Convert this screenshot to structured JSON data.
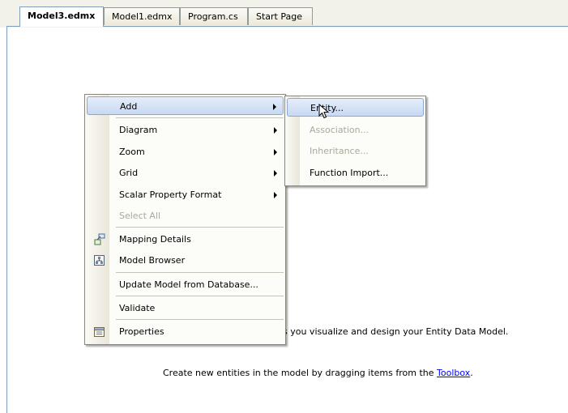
{
  "tabs": [
    {
      "label": "Model3.edmx",
      "active": true
    },
    {
      "label": "Model1.edmx",
      "active": false
    },
    {
      "label": "Program.cs",
      "active": false
    },
    {
      "label": "Start Page",
      "active": false
    }
  ],
  "designer": {
    "hint_line1_visible": "s you visualize and design your Entity Data Model.",
    "hint_line2_prefix": "Create new entities in the model by dragging items from the ",
    "hint_line2_link": "Toolbox",
    "hint_line2_suffix": "."
  },
  "context_menu": {
    "items": [
      {
        "label": "Add",
        "submenu": true,
        "highlighted": true
      },
      {
        "label": "Diagram",
        "submenu": true
      },
      {
        "label": "Zoom",
        "submenu": true
      },
      {
        "label": "Grid",
        "submenu": true
      },
      {
        "label": "Scalar Property Format",
        "submenu": true
      },
      {
        "label": "Select All",
        "disabled": true
      },
      {
        "label": "Mapping Details",
        "icon": "mapping-details-icon"
      },
      {
        "label": "Model Browser",
        "icon": "model-browser-icon"
      },
      {
        "label": "Update Model from Database..."
      },
      {
        "label": "Validate"
      },
      {
        "label": "Properties",
        "icon": "properties-icon"
      }
    ]
  },
  "add_submenu": {
    "items": [
      {
        "label": "Entity...",
        "highlighted": true
      },
      {
        "label": "Association...",
        "disabled": true
      },
      {
        "label": "Inheritance...",
        "disabled": true
      },
      {
        "label": "Function Import..."
      }
    ]
  },
  "colors": {
    "highlight_border": "#8da7d3",
    "disabled_text": "#aca899",
    "link": "#0000ff"
  }
}
